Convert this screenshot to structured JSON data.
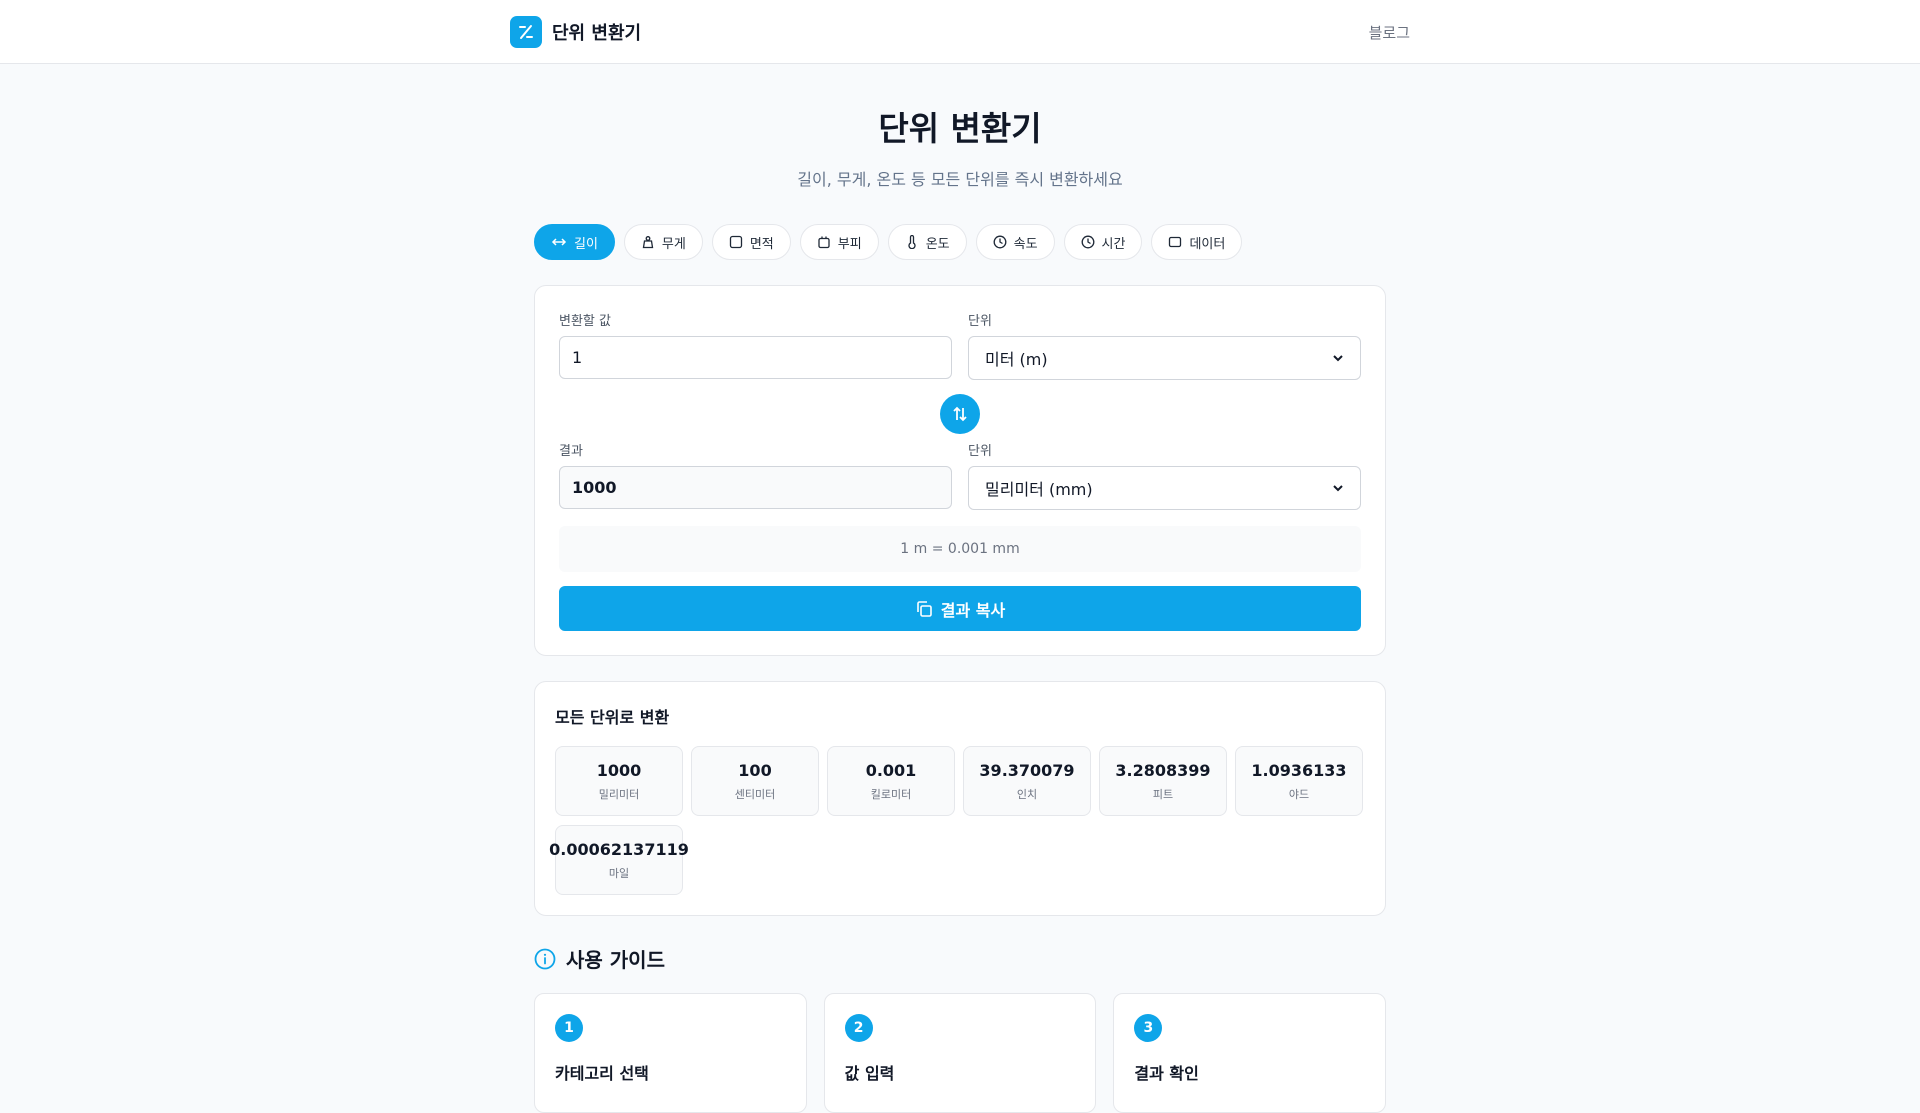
{
  "header": {
    "brand": "단위 변환기",
    "nav_link": "블로그"
  },
  "hero": {
    "title": "단위 변환기",
    "subtitle": "길이, 무게, 온도 등 모든 단위를 즉시 변환하세요"
  },
  "tabs": [
    {
      "label": "길이",
      "icon": "ruler-arrows-icon",
      "active": true
    },
    {
      "label": "무게",
      "icon": "weight-icon",
      "active": false
    },
    {
      "label": "면적",
      "icon": "square-icon",
      "active": false
    },
    {
      "label": "부피",
      "icon": "container-icon",
      "active": false
    },
    {
      "label": "온도",
      "icon": "thermometer-icon",
      "active": false
    },
    {
      "label": "속도",
      "icon": "gauge-icon",
      "active": false
    },
    {
      "label": "시간",
      "icon": "clock-icon",
      "active": false
    },
    {
      "label": "데이터",
      "icon": "storage-icon",
      "active": false
    }
  ],
  "converter": {
    "input_label": "변환할 값",
    "input_value": "1",
    "from_unit_label": "단위",
    "from_unit": "미터 (m)",
    "result_label": "결과",
    "result_value": "1000",
    "to_unit_label": "단위",
    "to_unit": "밀리미터 (mm)",
    "ratio_text": "1 m = 0.001 mm",
    "copy_label": "결과 복사"
  },
  "all_units": {
    "title": "모든 단위로 변환",
    "items": [
      {
        "value": "1000",
        "name": "밀리미터"
      },
      {
        "value": "100",
        "name": "센티미터"
      },
      {
        "value": "0.001",
        "name": "킬로미터"
      },
      {
        "value": "39.370079",
        "name": "인치"
      },
      {
        "value": "3.2808399",
        "name": "피트"
      },
      {
        "value": "1.0936133",
        "name": "야드"
      },
      {
        "value": "0.00062137119",
        "name": "마일"
      }
    ]
  },
  "guide": {
    "title": "사용 가이드",
    "steps": [
      {
        "num": "1",
        "title": "카테고리 선택"
      },
      {
        "num": "2",
        "title": "값 입력"
      },
      {
        "num": "3",
        "title": "결과 확인"
      }
    ]
  },
  "colors": {
    "accent": "#0ea5e9",
    "background": "#f8fafc",
    "border": "#e5e7eb"
  }
}
